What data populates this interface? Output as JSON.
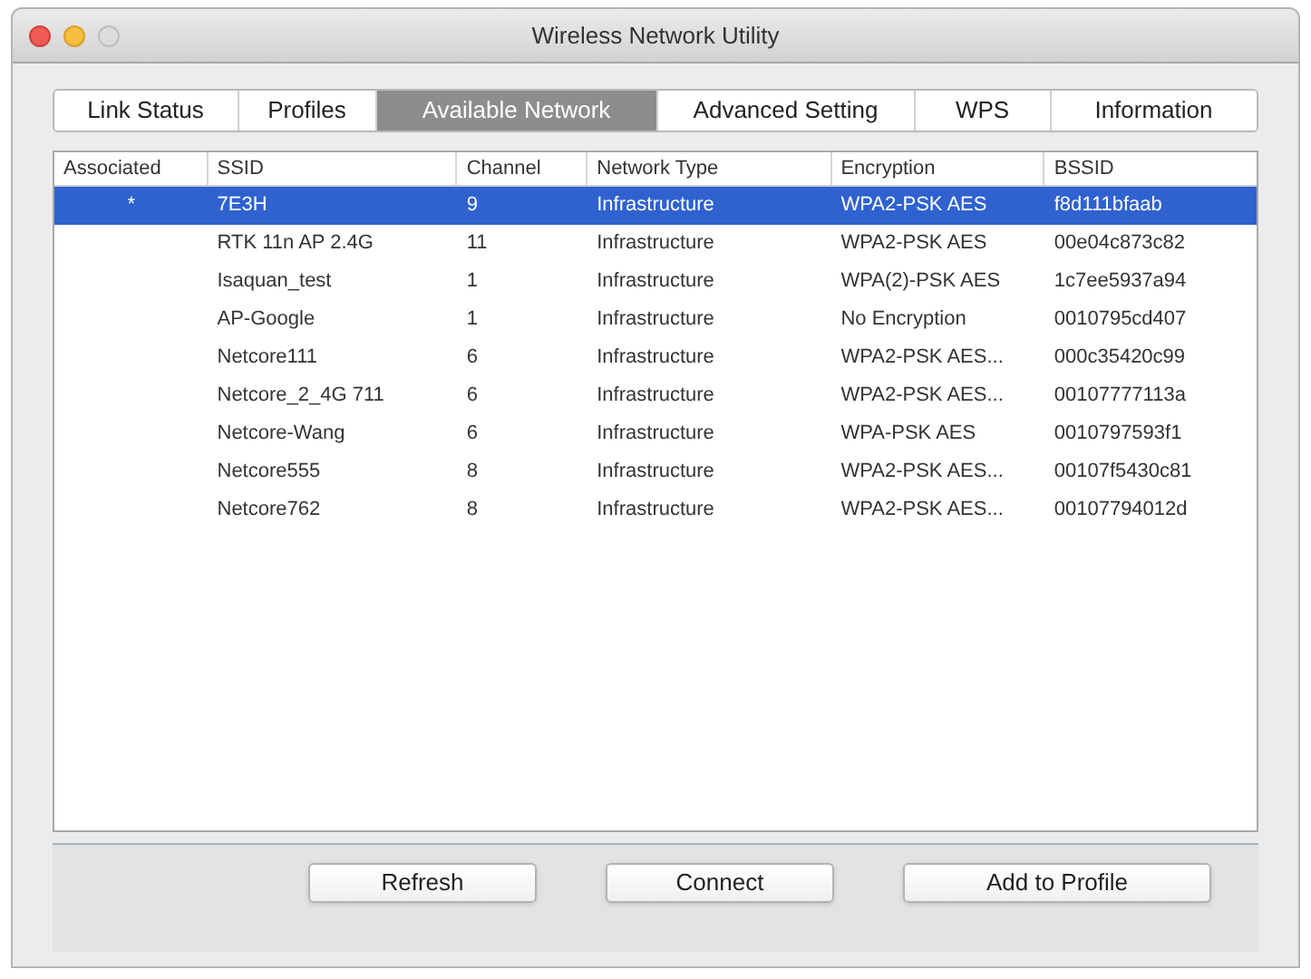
{
  "window": {
    "title": "Wireless Network Utility"
  },
  "tabs": [
    {
      "label": "Link Status",
      "selected": false
    },
    {
      "label": "Profiles",
      "selected": false
    },
    {
      "label": "Available Network",
      "selected": true
    },
    {
      "label": "Advanced Setting",
      "selected": false
    },
    {
      "label": "WPS",
      "selected": false
    },
    {
      "label": "Information",
      "selected": false
    }
  ],
  "table": {
    "columns": [
      "Associated",
      "SSID",
      "Channel",
      "Network Type",
      "Encryption",
      "BSSID"
    ],
    "rows": [
      {
        "selected": true,
        "cells": [
          "*",
          "7E3H",
          "9",
          "Infrastructure",
          "WPA2-PSK AES",
          "f8d111bfaab"
        ]
      },
      {
        "selected": false,
        "cells": [
          "",
          "RTK 11n AP 2.4G",
          "11",
          "Infrastructure",
          "WPA2-PSK AES",
          "00e04c873c82"
        ]
      },
      {
        "selected": false,
        "cells": [
          "",
          "Isaquan_test",
          "1",
          "Infrastructure",
          "WPA(2)-PSK AES",
          "1c7ee5937a94"
        ]
      },
      {
        "selected": false,
        "cells": [
          "",
          "AP-Google",
          "1",
          "Infrastructure",
          "No Encryption",
          "0010795cd407"
        ]
      },
      {
        "selected": false,
        "cells": [
          "",
          "Netcore111",
          "6",
          "Infrastructure",
          "WPA2-PSK AES...",
          "000c35420c99"
        ]
      },
      {
        "selected": false,
        "cells": [
          "",
          "Netcore_2_4G 711",
          "6",
          "Infrastructure",
          "WPA2-PSK AES...",
          "00107777113a"
        ]
      },
      {
        "selected": false,
        "cells": [
          "",
          "Netcore-Wang",
          "6",
          "Infrastructure",
          "WPA-PSK AES",
          "0010797593f1"
        ]
      },
      {
        "selected": false,
        "cells": [
          "",
          "Netcore555",
          "8",
          "Infrastructure",
          "WPA2-PSK AES...",
          "00107f5430c81"
        ]
      },
      {
        "selected": false,
        "cells": [
          "",
          "Netcore762",
          "8",
          "Infrastructure",
          "WPA2-PSK AES...",
          "00107794012d"
        ]
      }
    ]
  },
  "buttons": [
    "Refresh",
    "Connect",
    "Add to Profile"
  ]
}
